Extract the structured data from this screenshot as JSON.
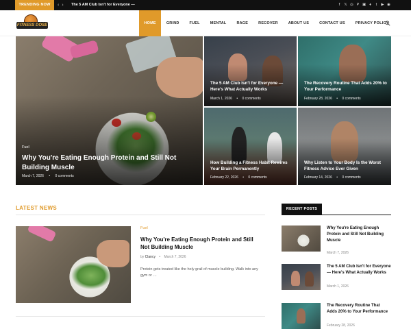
{
  "topbar": {
    "trending_label": "TRENDING NOW",
    "prev_arrow": "‹",
    "next_arrow": "›",
    "trending_text": "The 5 AM Club Isn't for Everyone —",
    "social": [
      "f",
      "𝕏",
      "◎",
      "P",
      "▣",
      "♦",
      "t",
      "▶",
      "◉"
    ]
  },
  "brand": {
    "logo_text": "FITNESS DOSE"
  },
  "nav": {
    "items": [
      "HOME",
      "GRIND",
      "FUEL",
      "MENTAL",
      "RAGE",
      "RECOVER",
      "ABOUT US",
      "CONTACT US",
      "PRIVACY POLICY"
    ]
  },
  "hero": {
    "big": {
      "category": "Fuel",
      "title": "Why You're Eating Enough Protein and Still Not Building Muscle",
      "date": "March 7, 2026",
      "comments": "0 comments"
    },
    "tiles": [
      {
        "title": "The 5 AM Club Isn't for Everyone — Here's What Actually Works",
        "date": "March 1, 2026",
        "comments": "0 comments"
      },
      {
        "title": "The Recovery Routine That Adds 20% to Your Performance",
        "date": "February 28, 2026",
        "comments": "0 comments"
      },
      {
        "title": "How Building a Fitness Habit Rewires Your Brain Permanently",
        "date": "February 22, 2026",
        "comments": "0 comments"
      },
      {
        "title": "Why Listen to Your Body Is the Worst Fitness Advice Ever Given",
        "date": "February 14, 2026",
        "comments": "0 comments"
      }
    ]
  },
  "latest": {
    "heading": "LATEST NEWS",
    "post": {
      "category": "Fuel",
      "title": "Why You're Eating Enough Protein and Still Not Building Muscle",
      "author_prefix": "by",
      "author": "Clancy",
      "date": "March 7, 2026",
      "excerpt": "Protein gets treated like the holy grail of muscle building. Walk into any gym or …"
    }
  },
  "sidebar": {
    "heading": "RECENT POSTS",
    "posts": [
      {
        "title": "Why You're Eating Enough Protein and Still Not Building Muscle",
        "date": "March 7, 2026"
      },
      {
        "title": "The 5 AM Club Isn't for Everyone — Here's What Actually Works",
        "date": "March 1, 2026"
      },
      {
        "title": "The Recovery Routine That Adds 20% to Your Performance",
        "date": "February 28, 2026"
      }
    ]
  },
  "colors": {
    "accent": "#e09a2a",
    "dark": "#111111"
  }
}
